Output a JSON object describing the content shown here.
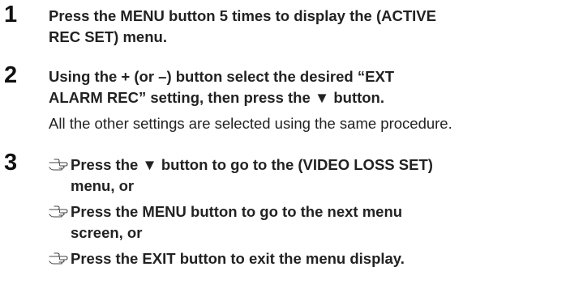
{
  "steps": [
    {
      "number": "1",
      "lines": [
        "Press the MENU button 5 times to display the (ACTIVE",
        "REC SET) menu."
      ]
    },
    {
      "number": "2",
      "lines": [
        "Using the + (or –) button select the desired “EXT",
        "ALARM REC” setting, then press the ▼ button."
      ],
      "note": "All the other settings are selected using the same procedure."
    },
    {
      "number": "3",
      "options": [
        {
          "icon": "pointing-hand-icon",
          "lines": [
            "Press the ▼ button to go to the (VIDEO LOSS SET)",
            "menu, or"
          ]
        },
        {
          "icon": "pointing-hand-icon",
          "lines": [
            "Press the MENU button to go to the next menu",
            "screen, or"
          ]
        },
        {
          "icon": "pointing-hand-icon",
          "lines": [
            "Press the EXIT button to exit the menu display."
          ]
        }
      ]
    }
  ]
}
